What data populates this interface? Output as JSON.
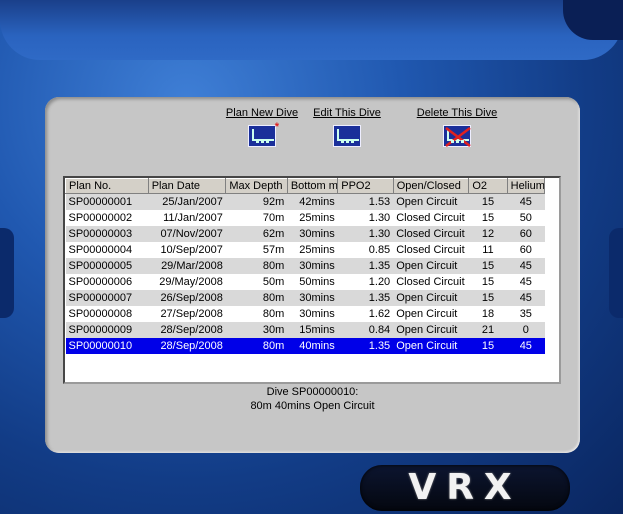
{
  "toolbar": {
    "plan_new": "Plan New Dive",
    "edit": "Edit This Dive",
    "delete": "Delete This Dive"
  },
  "table": {
    "headers": [
      "Plan No.",
      "Plan Date",
      "Max Depth",
      "Bottom m",
      "PPO2",
      "Open/Closed",
      "O2",
      "Helium"
    ],
    "rows": [
      [
        "SP00000001",
        "25/Jan/2007",
        "92m",
        "42mins",
        "1.53",
        "Open Circuit",
        "15",
        "45"
      ],
      [
        "SP00000002",
        "11/Jan/2007",
        "70m",
        "25mins",
        "1.30",
        "Closed Circuit",
        "15",
        "50"
      ],
      [
        "SP00000003",
        "07/Nov/2007",
        "62m",
        "30mins",
        "1.30",
        "Closed Circuit",
        "12",
        "60"
      ],
      [
        "SP00000004",
        "10/Sep/2007",
        "57m",
        "25mins",
        "0.85",
        "Closed Circuit",
        "11",
        "60"
      ],
      [
        "SP00000005",
        "29/Mar/2008",
        "80m",
        "30mins",
        "1.35",
        "Open Circuit",
        "15",
        "45"
      ],
      [
        "SP00000006",
        "29/May/2008",
        "50m",
        "50mins",
        "1.20",
        "Closed Circuit",
        "15",
        "45"
      ],
      [
        "SP00000007",
        "26/Sep/2008",
        "80m",
        "30mins",
        "1.35",
        "Open Circuit",
        "15",
        "45"
      ],
      [
        "SP00000008",
        "27/Sep/2008",
        "80m",
        "30mins",
        "1.62",
        "Open Circuit",
        "18",
        "35"
      ],
      [
        "SP00000009",
        "28/Sep/2008",
        "30m",
        "15mins",
        "0.84",
        "Open Circuit",
        "21",
        "0"
      ],
      [
        "SP00000010",
        "28/Sep/2008",
        "80m",
        "40mins",
        "1.35",
        "Open Circuit",
        "15",
        "45"
      ]
    ],
    "selected_index": 9
  },
  "caption": {
    "line1": "Dive SP00000010:",
    "line2": "80m 40mins Open Circuit"
  },
  "logo": "VRX",
  "colors": {
    "selection": "#0000e8",
    "housing": "#2058b0",
    "screen": "#c6c6c6"
  }
}
